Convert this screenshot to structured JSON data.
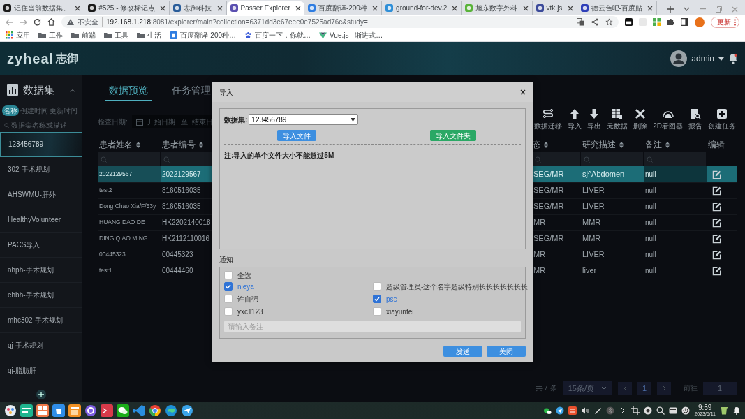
{
  "browser": {
    "tabs": [
      {
        "title": "记住当前数据集。",
        "selected": false
      },
      {
        "title": "#525 - 修改标记点",
        "selected": false
      },
      {
        "title": "志御科技",
        "selected": false
      },
      {
        "title": "Passer Explorer",
        "selected": true
      },
      {
        "title": "百度翻译-200种",
        "selected": false
      },
      {
        "title": "ground-for-dev.2",
        "selected": false
      },
      {
        "title": "旭东数字外科",
        "selected": false
      },
      {
        "title": "vtk.js",
        "selected": false
      },
      {
        "title": "德云色吧-百度贴",
        "selected": false
      }
    ],
    "address": {
      "security": "不安全",
      "host": "192.168.1.218",
      "path": ":8081/explorer/main?collection=6371dd3e67eee0e7525ad76c&study="
    },
    "update_button": "更新",
    "bookmarks": [
      {
        "label": "应用",
        "kind": "apps"
      },
      {
        "label": "工作",
        "kind": "folder"
      },
      {
        "label": "前端",
        "kind": "folder"
      },
      {
        "label": "工具",
        "kind": "folder"
      },
      {
        "label": "生活",
        "kind": "folder"
      },
      {
        "label": "百度翻译-200种…",
        "kind": "site"
      },
      {
        "label": "百度一下，你就…",
        "kind": "paw"
      },
      {
        "label": "Vue.js - 渐进式…",
        "kind": "vue"
      }
    ]
  },
  "app": {
    "logo": "zyheal",
    "logo_cjk": "志御",
    "user": "admin"
  },
  "sidebar": {
    "title": "数据集",
    "sort_options": [
      {
        "label": "名称",
        "selected": true
      },
      {
        "label": "创建时间",
        "selected": false
      },
      {
        "label": "更新时间",
        "selected": false
      }
    ],
    "search_placeholder": "数据集名称或描述",
    "items": [
      {
        "label": "123456789",
        "selected": true
      },
      {
        "label": "302-手术规划",
        "selected": false
      },
      {
        "label": "AHSWMU-肝外",
        "selected": false
      },
      {
        "label": "HealthyVolunteer",
        "selected": false
      },
      {
        "label": "PACS导入",
        "selected": false
      },
      {
        "label": "ahph-手术规划",
        "selected": false
      },
      {
        "label": "ehbh-手术规划",
        "selected": false
      },
      {
        "label": "mhc302-手术规划",
        "selected": false
      },
      {
        "label": "qj-手术规划",
        "selected": false
      },
      {
        "label": "qj-脂肪肝",
        "selected": false
      }
    ]
  },
  "main": {
    "tabs": [
      {
        "label": "数据预览",
        "selected": true
      },
      {
        "label": "任务管理",
        "selected": false
      }
    ],
    "date_filter": {
      "label": "检查日期:",
      "start_placeholder": "开始日期",
      "separator": "至",
      "end_placeholder": "结束日"
    },
    "toolbar": [
      "数据迁移",
      "导入",
      "导出",
      "元数据",
      "删除",
      "2D看图器",
      "报告",
      "创建任务"
    ],
    "table": {
      "columns": [
        {
          "label": "患者姓名",
          "sortable": true
        },
        {
          "label": "患者编号",
          "sortable": true
        },
        {
          "label": "态",
          "sortable": true
        },
        {
          "label": "研究描述",
          "sortable": true
        },
        {
          "label": "备注",
          "sortable": true
        },
        {
          "label": "编辑",
          "sortable": false
        }
      ],
      "rows": [
        {
          "cells": [
            "2022129567",
            "2022129567",
            "SEG/MR",
            "sj^Abdomen",
            "null"
          ],
          "selected": true
        },
        {
          "cells": [
            "test2",
            "8160516035",
            "SEG/MR",
            "LIVER",
            "null"
          ],
          "selected": false
        },
        {
          "cells": [
            "Dong Chao Xia/F/53y",
            "8160516035",
            "SEG/MR",
            "LIVER",
            "null"
          ],
          "selected": false
        },
        {
          "cells": [
            "HUANG DAO DE",
            "HK2202140018",
            "MR",
            "MMR",
            "null"
          ],
          "selected": false
        },
        {
          "cells": [
            "DING QIAO MING",
            "HK2112110016",
            "SEG/MR",
            "MMR",
            "null"
          ],
          "selected": false
        },
        {
          "cells": [
            "00445323",
            "00445323",
            "MR",
            "LIVER",
            "null"
          ],
          "selected": false
        },
        {
          "cells": [
            "test1",
            "00444460",
            "MR",
            "liver",
            "null"
          ],
          "selected": false
        }
      ]
    },
    "pagination": {
      "total": "共 7 条",
      "page_size": "15条/页",
      "page": "1",
      "goto_label": "前往",
      "goto_value": "1"
    }
  },
  "dialog": {
    "title": "导入",
    "dataset_label": "数据集:",
    "dataset_value": "123456789",
    "buttons": [
      {
        "label": "导入文件",
        "kind": "primary"
      },
      {
        "label": "导入文件夹",
        "kind": "success"
      }
    ],
    "note": "注:导入的单个文件大小不能超过5M",
    "notify_title": "通知",
    "select_all": {
      "label": "全选",
      "checked": false
    },
    "users": [
      {
        "name": "nieya",
        "checked": true
      },
      {
        "name": "超级管理员-这个名字超级特别长长长长长长长",
        "checked": false
      },
      {
        "name": "许自强",
        "checked": false
      },
      {
        "name": "psc",
        "checked": true
      },
      {
        "name": "yxc1123",
        "checked": false
      },
      {
        "name": "xiayunfei",
        "checked": false
      }
    ],
    "remark_placeholder": "请输入备注",
    "actions": [
      {
        "label": "发送",
        "kind": "primary"
      },
      {
        "label": "关闭",
        "kind": "primary"
      }
    ]
  },
  "taskbar": {
    "time": "9:59",
    "date": "2023/5/11"
  }
}
